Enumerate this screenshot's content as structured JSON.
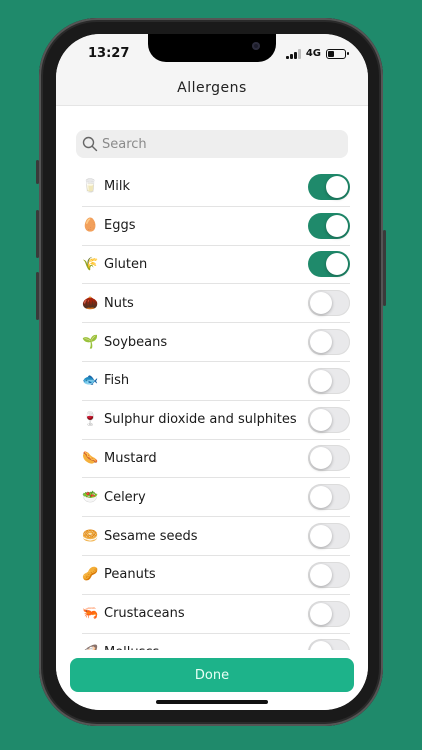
{
  "status_bar": {
    "time": "13:27",
    "network": "4G"
  },
  "header": {
    "title": "Allergens"
  },
  "search": {
    "placeholder": "Search",
    "value": ""
  },
  "allergens": [
    {
      "emoji": "🥛",
      "label": "Milk",
      "enabled": true
    },
    {
      "emoji": "🥚",
      "label": "Eggs",
      "enabled": true
    },
    {
      "emoji": "🌾",
      "label": "Gluten",
      "enabled": true
    },
    {
      "emoji": "🌰",
      "label": "Nuts",
      "enabled": false
    },
    {
      "emoji": "🌱",
      "label": "Soybeans",
      "enabled": false
    },
    {
      "emoji": "🐟",
      "label": "Fish",
      "enabled": false
    },
    {
      "emoji": "🍷",
      "label": "Sulphur dioxide and sulphites",
      "enabled": false
    },
    {
      "emoji": "🌭",
      "label": "Mustard",
      "enabled": false
    },
    {
      "emoji": "🥗",
      "label": "Celery",
      "enabled": false
    },
    {
      "emoji": "🥯",
      "label": "Sesame seeds",
      "enabled": false
    },
    {
      "emoji": "🥜",
      "label": "Peanuts",
      "enabled": false
    },
    {
      "emoji": "🦐",
      "label": "Crustaceans",
      "enabled": false
    },
    {
      "emoji": "🦪",
      "label": "Molluscs",
      "enabled": false
    }
  ],
  "footer": {
    "done_label": "Done"
  },
  "colors": {
    "background": "#1f8a6b",
    "toggle_on": "#1f8a6b",
    "done_button": "#1db38a"
  }
}
